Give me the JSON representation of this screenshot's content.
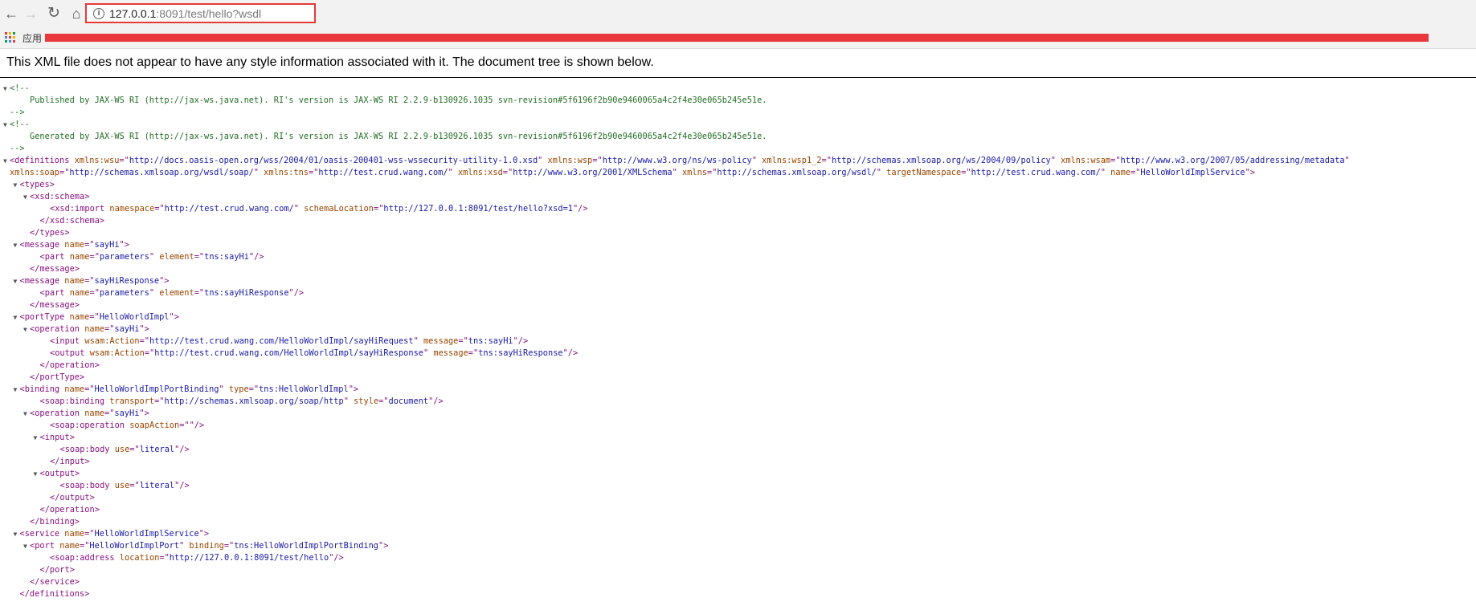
{
  "browser": {
    "url_host": "127.0.0.1",
    "url_rest": ":8091/test/hello?wsdl",
    "bookmarks_label": "应用",
    "icons": [
      "back-arrow-icon",
      "forward-arrow-icon",
      "reload-icon",
      "home-icon",
      "info-icon",
      "apps-grid-icon"
    ],
    "colors": {
      "highlight": "#e53935",
      "redacted_bar": "#e8383b",
      "tag": "#881280",
      "attr_name": "#994500",
      "attr_value": "#1a1aa6",
      "comment": "#236e25"
    }
  },
  "notice": "This XML file does not appear to have any style information associated with it. The document tree is shown below.",
  "lines": [
    {
      "i": 0,
      "t": true,
      "p": [
        [
          "cm",
          "<!--"
        ]
      ]
    },
    {
      "i": 2,
      "p": [
        [
          "cm",
          "Published by JAX-WS RI (http://jax-ws.java.net). RI's version is JAX-WS RI 2.2.9-b130926.1035 svn-revision#5f6196f2b90e9460065a4c2f4e30e065b245e51e."
        ]
      ]
    },
    {
      "i": 0,
      "p": [
        [
          "cm",
          "-->"
        ]
      ]
    },
    {
      "i": 0,
      "t": true,
      "p": [
        [
          "cm",
          "<!--"
        ]
      ]
    },
    {
      "i": 2,
      "p": [
        [
          "cm",
          "Generated by JAX-WS RI (http://jax-ws.java.net). RI's version is JAX-WS RI 2.2.9-b130926.1035 svn-revision#5f6196f2b90e9460065a4c2f4e30e065b245e51e."
        ]
      ]
    },
    {
      "i": 0,
      "p": [
        [
          "cm",
          "-->"
        ]
      ]
    },
    {
      "i": 0,
      "t": true,
      "p": [
        [
          "tg",
          "<definitions"
        ],
        [
          "an",
          " xmlns:wsu"
        ],
        [
          "tg",
          "=\""
        ],
        [
          "av",
          "http://docs.oasis-open.org/wss/2004/01/oasis-200401-wss-wssecurity-utility-1.0.xsd"
        ],
        [
          "tg",
          "\""
        ],
        [
          "an",
          " xmlns:wsp"
        ],
        [
          "tg",
          "=\""
        ],
        [
          "av",
          "http://www.w3.org/ns/ws-policy"
        ],
        [
          "tg",
          "\""
        ],
        [
          "an",
          " xmlns:wsp1_2"
        ],
        [
          "tg",
          "=\""
        ],
        [
          "av",
          "http://schemas.xmlsoap.org/ws/2004/09/policy"
        ],
        [
          "tg",
          "\""
        ],
        [
          "an",
          " xmlns:wsam"
        ],
        [
          "tg",
          "=\""
        ],
        [
          "av",
          "http://www.w3.org/2007/05/addressing/metadata"
        ],
        [
          "tg",
          "\""
        ]
      ]
    },
    {
      "i": 0,
      "p": [
        [
          "an",
          "xmlns:soap"
        ],
        [
          "tg",
          "=\""
        ],
        [
          "av",
          "http://schemas.xmlsoap.org/wsdl/soap/"
        ],
        [
          "tg",
          "\""
        ],
        [
          "an",
          " xmlns:tns"
        ],
        [
          "tg",
          "=\""
        ],
        [
          "av",
          "http://test.crud.wang.com/"
        ],
        [
          "tg",
          "\""
        ],
        [
          "an",
          " xmlns:xsd"
        ],
        [
          "tg",
          "=\""
        ],
        [
          "av",
          "http://www.w3.org/2001/XMLSchema"
        ],
        [
          "tg",
          "\""
        ],
        [
          "an",
          " xmlns"
        ],
        [
          "tg",
          "=\""
        ],
        [
          "av",
          "http://schemas.xmlsoap.org/wsdl/"
        ],
        [
          "tg",
          "\""
        ],
        [
          "an",
          " targetNamespace"
        ],
        [
          "tg",
          "=\""
        ],
        [
          "av",
          "http://test.crud.wang.com/"
        ],
        [
          "tg",
          "\""
        ],
        [
          "an",
          " name"
        ],
        [
          "tg",
          "=\""
        ],
        [
          "av",
          "HelloWorldImplService"
        ],
        [
          "tg",
          "\">"
        ]
      ]
    },
    {
      "i": 1,
      "t": true,
      "p": [
        [
          "tg",
          "<types>"
        ]
      ]
    },
    {
      "i": 2,
      "t": true,
      "p": [
        [
          "tg",
          "<xsd:schema>"
        ]
      ]
    },
    {
      "i": 4,
      "p": [
        [
          "tg",
          "<xsd:import"
        ],
        [
          "an",
          " namespace"
        ],
        [
          "tg",
          "=\""
        ],
        [
          "av",
          "http://test.crud.wang.com/"
        ],
        [
          "tg",
          "\""
        ],
        [
          "an",
          " schemaLocation"
        ],
        [
          "tg",
          "=\""
        ],
        [
          "av",
          "http://127.0.0.1:8091/test/hello?xsd=1"
        ],
        [
          "tg",
          "\"/>"
        ]
      ]
    },
    {
      "i": 3,
      "p": [
        [
          "tg",
          "</xsd:schema>"
        ]
      ]
    },
    {
      "i": 2,
      "p": [
        [
          "tg",
          "</types>"
        ]
      ]
    },
    {
      "i": 1,
      "t": true,
      "p": [
        [
          "tg",
          "<message"
        ],
        [
          "an",
          " name"
        ],
        [
          "tg",
          "=\""
        ],
        [
          "av",
          "sayHi"
        ],
        [
          "tg",
          "\">"
        ]
      ]
    },
    {
      "i": 3,
      "p": [
        [
          "tg",
          "<part"
        ],
        [
          "an",
          " name"
        ],
        [
          "tg",
          "=\""
        ],
        [
          "av",
          "parameters"
        ],
        [
          "tg",
          "\""
        ],
        [
          "an",
          " element"
        ],
        [
          "tg",
          "=\""
        ],
        [
          "av",
          "tns:sayHi"
        ],
        [
          "tg",
          "\"/>"
        ]
      ]
    },
    {
      "i": 2,
      "p": [
        [
          "tg",
          "</message>"
        ]
      ]
    },
    {
      "i": 1,
      "t": true,
      "p": [
        [
          "tg",
          "<message"
        ],
        [
          "an",
          " name"
        ],
        [
          "tg",
          "=\""
        ],
        [
          "av",
          "sayHiResponse"
        ],
        [
          "tg",
          "\">"
        ]
      ]
    },
    {
      "i": 3,
      "p": [
        [
          "tg",
          "<part"
        ],
        [
          "an",
          " name"
        ],
        [
          "tg",
          "=\""
        ],
        [
          "av",
          "parameters"
        ],
        [
          "tg",
          "\""
        ],
        [
          "an",
          " element"
        ],
        [
          "tg",
          "=\""
        ],
        [
          "av",
          "tns:sayHiResponse"
        ],
        [
          "tg",
          "\"/>"
        ]
      ]
    },
    {
      "i": 2,
      "p": [
        [
          "tg",
          "</message>"
        ]
      ]
    },
    {
      "i": 1,
      "t": true,
      "p": [
        [
          "tg",
          "<portType"
        ],
        [
          "an",
          " name"
        ],
        [
          "tg",
          "=\""
        ],
        [
          "av",
          "HelloWorldImpl"
        ],
        [
          "tg",
          "\">"
        ]
      ]
    },
    {
      "i": 2,
      "t": true,
      "p": [
        [
          "tg",
          "<operation"
        ],
        [
          "an",
          " name"
        ],
        [
          "tg",
          "=\""
        ],
        [
          "av",
          "sayHi"
        ],
        [
          "tg",
          "\">"
        ]
      ]
    },
    {
      "i": 4,
      "p": [
        [
          "tg",
          "<input"
        ],
        [
          "an",
          " wsam:Action"
        ],
        [
          "tg",
          "=\""
        ],
        [
          "av",
          "http://test.crud.wang.com/HelloWorldImpl/sayHiRequest"
        ],
        [
          "tg",
          "\""
        ],
        [
          "an",
          " message"
        ],
        [
          "tg",
          "=\""
        ],
        [
          "av",
          "tns:sayHi"
        ],
        [
          "tg",
          "\"/>"
        ]
      ]
    },
    {
      "i": 4,
      "p": [
        [
          "tg",
          "<output"
        ],
        [
          "an",
          " wsam:Action"
        ],
        [
          "tg",
          "=\""
        ],
        [
          "av",
          "http://test.crud.wang.com/HelloWorldImpl/sayHiResponse"
        ],
        [
          "tg",
          "\""
        ],
        [
          "an",
          " message"
        ],
        [
          "tg",
          "=\""
        ],
        [
          "av",
          "tns:sayHiResponse"
        ],
        [
          "tg",
          "\"/>"
        ]
      ]
    },
    {
      "i": 3,
      "p": [
        [
          "tg",
          "</operation>"
        ]
      ]
    },
    {
      "i": 2,
      "p": [
        [
          "tg",
          "</portType>"
        ]
      ]
    },
    {
      "i": 1,
      "t": true,
      "p": [
        [
          "tg",
          "<binding"
        ],
        [
          "an",
          " name"
        ],
        [
          "tg",
          "=\""
        ],
        [
          "av",
          "HelloWorldImplPortBinding"
        ],
        [
          "tg",
          "\""
        ],
        [
          "an",
          " type"
        ],
        [
          "tg",
          "=\""
        ],
        [
          "av",
          "tns:HelloWorldImpl"
        ],
        [
          "tg",
          "\">"
        ]
      ]
    },
    {
      "i": 3,
      "p": [
        [
          "tg",
          "<soap:binding"
        ],
        [
          "an",
          " transport"
        ],
        [
          "tg",
          "=\""
        ],
        [
          "av",
          "http://schemas.xmlsoap.org/soap/http"
        ],
        [
          "tg",
          "\""
        ],
        [
          "an",
          " style"
        ],
        [
          "tg",
          "=\""
        ],
        [
          "av",
          "document"
        ],
        [
          "tg",
          "\"/>"
        ]
      ]
    },
    {
      "i": 2,
      "t": true,
      "p": [
        [
          "tg",
          "<operation"
        ],
        [
          "an",
          " name"
        ],
        [
          "tg",
          "=\""
        ],
        [
          "av",
          "sayHi"
        ],
        [
          "tg",
          "\">"
        ]
      ]
    },
    {
      "i": 4,
      "p": [
        [
          "tg",
          "<soap:operation"
        ],
        [
          "an",
          " soapAction"
        ],
        [
          "tg",
          "=\"\"/>"
        ]
      ]
    },
    {
      "i": 3,
      "t": true,
      "p": [
        [
          "tg",
          "<input>"
        ]
      ]
    },
    {
      "i": 5,
      "p": [
        [
          "tg",
          "<soap:body"
        ],
        [
          "an",
          " use"
        ],
        [
          "tg",
          "=\""
        ],
        [
          "av",
          "literal"
        ],
        [
          "tg",
          "\"/>"
        ]
      ]
    },
    {
      "i": 4,
      "p": [
        [
          "tg",
          "</input>"
        ]
      ]
    },
    {
      "i": 3,
      "t": true,
      "p": [
        [
          "tg",
          "<output>"
        ]
      ]
    },
    {
      "i": 5,
      "p": [
        [
          "tg",
          "<soap:body"
        ],
        [
          "an",
          " use"
        ],
        [
          "tg",
          "=\""
        ],
        [
          "av",
          "literal"
        ],
        [
          "tg",
          "\"/>"
        ]
      ]
    },
    {
      "i": 4,
      "p": [
        [
          "tg",
          "</output>"
        ]
      ]
    },
    {
      "i": 3,
      "p": [
        [
          "tg",
          "</operation>"
        ]
      ]
    },
    {
      "i": 2,
      "p": [
        [
          "tg",
          "</binding>"
        ]
      ]
    },
    {
      "i": 1,
      "t": true,
      "p": [
        [
          "tg",
          "<service"
        ],
        [
          "an",
          " name"
        ],
        [
          "tg",
          "=\""
        ],
        [
          "av",
          "HelloWorldImplService"
        ],
        [
          "tg",
          "\">"
        ]
      ]
    },
    {
      "i": 2,
      "t": true,
      "p": [
        [
          "tg",
          "<port"
        ],
        [
          "an",
          " name"
        ],
        [
          "tg",
          "=\""
        ],
        [
          "av",
          "HelloWorldImplPort"
        ],
        [
          "tg",
          "\""
        ],
        [
          "an",
          " binding"
        ],
        [
          "tg",
          "=\""
        ],
        [
          "av",
          "tns:HelloWorldImplPortBinding"
        ],
        [
          "tg",
          "\">"
        ]
      ]
    },
    {
      "i": 4,
      "p": [
        [
          "tg",
          "<soap:address"
        ],
        [
          "an",
          " location"
        ],
        [
          "tg",
          "=\""
        ],
        [
          "av",
          "http://127.0.0.1:8091/test/hello"
        ],
        [
          "tg",
          "\"/>"
        ]
      ]
    },
    {
      "i": 3,
      "p": [
        [
          "tg",
          "</port>"
        ]
      ]
    },
    {
      "i": 2,
      "p": [
        [
          "tg",
          "</service>"
        ]
      ]
    },
    {
      "i": 1,
      "p": [
        [
          "tg",
          "</definitions>"
        ]
      ]
    }
  ]
}
